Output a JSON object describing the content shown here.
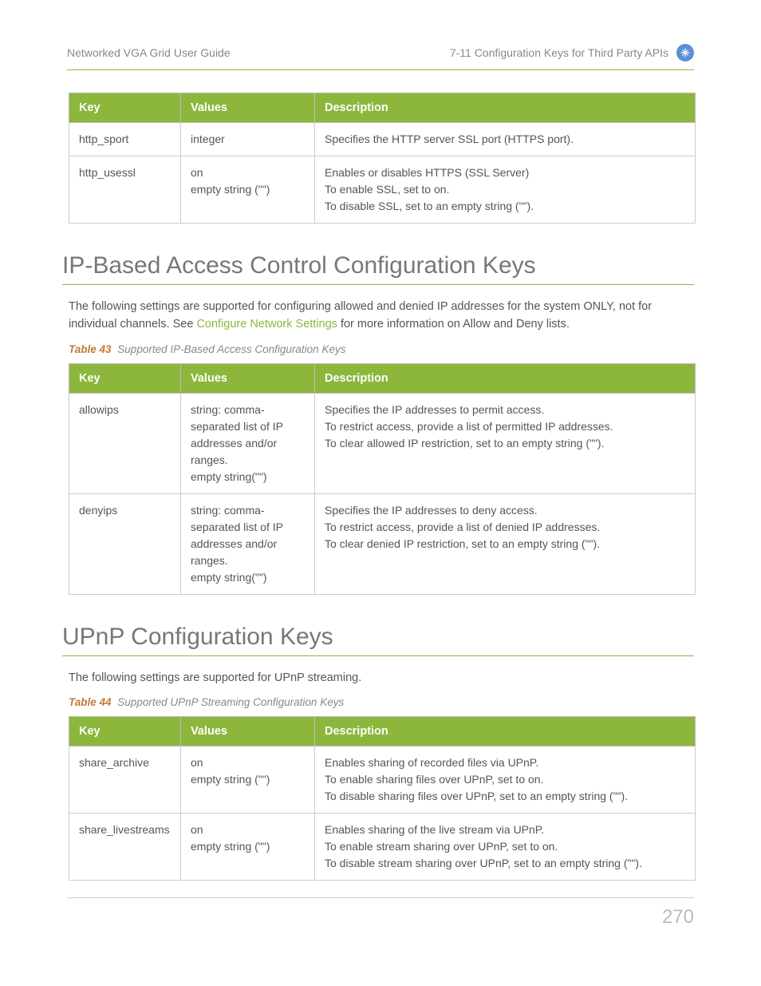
{
  "header": {
    "left": "Networked VGA Grid User Guide",
    "right": "7-11 Configuration Keys for Third Party APIs"
  },
  "columns": {
    "key": "Key",
    "values": "Values",
    "desc": "Description"
  },
  "table1": {
    "rows": [
      {
        "key": "http_sport",
        "values": "integer",
        "desc": "Specifies the HTTP server SSL port (HTTPS port)."
      },
      {
        "key": "http_usessl",
        "values": "on\nempty string (\"\")",
        "desc": "Enables or disables HTTPS (SSL Server)\nTo enable SSL, set to on.\nTo disable SSL, set to an empty string (\"\")."
      }
    ]
  },
  "section2": {
    "title": "IP-Based Access Control Configuration Keys",
    "intro_pre": "The following settings are supported for configuring allowed and denied IP addresses for the system ONLY, not for individual channels. See ",
    "intro_link": "Configure Network Settings",
    "intro_post": " for more information on Allow and Deny lists.",
    "caption_label": "Table 43",
    "caption_text": "Supported IP-Based Access Configuration Keys",
    "rows": [
      {
        "key": "allowips",
        "values": "string: comma-separated list of IP addresses and/or ranges.\nempty string(\"\")",
        "desc": "Specifies the IP addresses to permit access.\nTo restrict access, provide a list of permitted IP addresses.\nTo clear allowed IP restriction, set to an empty string (\"\")."
      },
      {
        "key": "denyips",
        "values": "string: comma-separated list of IP addresses and/or ranges.\nempty string(\"\")",
        "desc": "Specifies the IP addresses to deny access.\nTo restrict access, provide a list of denied IP addresses.\nTo clear denied IP restriction, set to an empty string (\"\")."
      }
    ]
  },
  "section3": {
    "title": "UPnP Configuration Keys",
    "intro": "The following settings are supported for UPnP streaming.",
    "caption_label": "Table 44",
    "caption_text": "Supported UPnP Streaming Configuration Keys",
    "rows": [
      {
        "key": "share_archive",
        "values": "on\nempty string (\"\")",
        "desc": "Enables sharing of recorded files via UPnP.\nTo enable sharing files over UPnP, set to on.\nTo disable sharing files over UPnP, set to an empty string (\"\")."
      },
      {
        "key": "share_livestreams",
        "values": "on\nempty string (\"\")",
        "desc": "Enables sharing of the live stream via UPnP.\nTo enable stream sharing over UPnP, set to on.\nTo disable stream sharing over UPnP, set to an empty string (\"\")."
      }
    ]
  },
  "page_number": "270"
}
